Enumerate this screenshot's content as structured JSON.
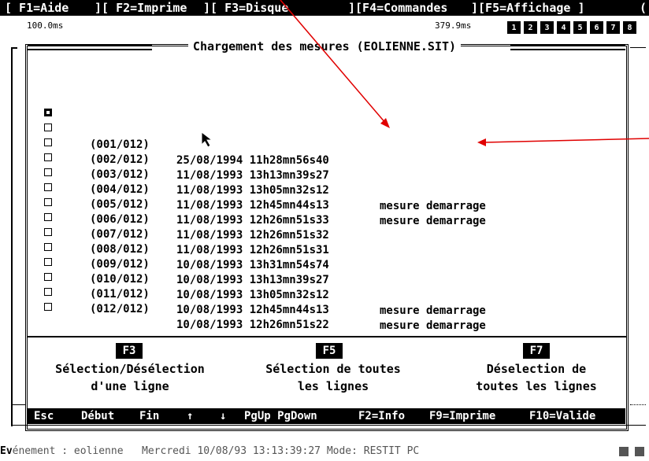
{
  "fkey_bar": [
    {
      "text": "[ F1=Aide"
    },
    {
      "text": "][ F2=Imprime"
    },
    {
      "text": "][ F3=Disque"
    },
    {
      "text": "][F4=Commandes"
    },
    {
      "text": "][F5=Affichage ]"
    },
    {
      "text": "("
    }
  ],
  "timing": {
    "left": "100.0ms",
    "right": "379.9ms"
  },
  "pages": [
    "1",
    "2",
    "3",
    "4",
    "5",
    "6",
    "7",
    "8"
  ],
  "window_title": "Chargement des mesures (EOLIENNE.SIT)",
  "rows": [
    {
      "checked": true,
      "idx": "(001/012)",
      "datetime": "25/08/1994 11h28mn56s40",
      "note": ""
    },
    {
      "checked": false,
      "idx": "(002/012)",
      "datetime": "11/08/1993 13h13mn39s27",
      "note": ""
    },
    {
      "checked": false,
      "idx": "(003/012)",
      "datetime": "11/08/1993 13h05mn32s12",
      "note": "mesure demarrage"
    },
    {
      "checked": false,
      "idx": "(004/012)",
      "datetime": "11/08/1993 12h45mn44s13",
      "note": "mesure demarrage"
    },
    {
      "checked": false,
      "idx": "(005/012)",
      "datetime": "11/08/1993 12h26mn51s33",
      "note": ""
    },
    {
      "checked": false,
      "idx": "(006/012)",
      "datetime": "11/08/1993 12h26mn51s32",
      "note": ""
    },
    {
      "checked": false,
      "idx": "(007/012)",
      "datetime": "11/08/1993 12h26mn51s31",
      "note": ""
    },
    {
      "checked": false,
      "idx": "(008/012)",
      "datetime": "10/08/1993 13h31mn54s74",
      "note": ""
    },
    {
      "checked": false,
      "idx": "(009/012)",
      "datetime": "10/08/1993 13h13mn39s27",
      "note": ""
    },
    {
      "checked": false,
      "idx": "(010/012)",
      "datetime": "10/08/1993 13h05mn32s12",
      "note": "mesure demarrage"
    },
    {
      "checked": false,
      "idx": "(011/012)",
      "datetime": "10/08/1993 12h45mn44s13",
      "note": "mesure demarrage"
    },
    {
      "checked": false,
      "idx": "(012/012)",
      "datetime": "10/08/1993 12h26mn51s22",
      "note": ""
    },
    {
      "checked": false,
      "idx": "",
      "datetime": "",
      "note": ""
    },
    {
      "checked": false,
      "idx": "",
      "datetime": "",
      "note": ""
    }
  ],
  "help": [
    {
      "key": "F3",
      "line1": "Sélection/Désélection",
      "line2": "d'une ligne"
    },
    {
      "key": "F5",
      "line1": "Sélection de toutes",
      "line2": "les lignes"
    },
    {
      "key": "F7",
      "line1": "Déselection de",
      "line2": "toutes les lignes"
    }
  ],
  "cmdbar": [
    "Esc",
    "Début",
    "Fin",
    "↑",
    "↓",
    "PgUp PgDown",
    "F2=Info",
    "F9=Imprime",
    "F10=Valide"
  ],
  "status": {
    "prefix": "Ev",
    "rest": "énement : eolienne   Mercredi 10/08/93 13:13:39:27 Mode: RESTIT PC"
  },
  "colors": {
    "annotation_arrow": "#e00000",
    "inverse_bg": "#000000",
    "status_text": "#555555"
  }
}
